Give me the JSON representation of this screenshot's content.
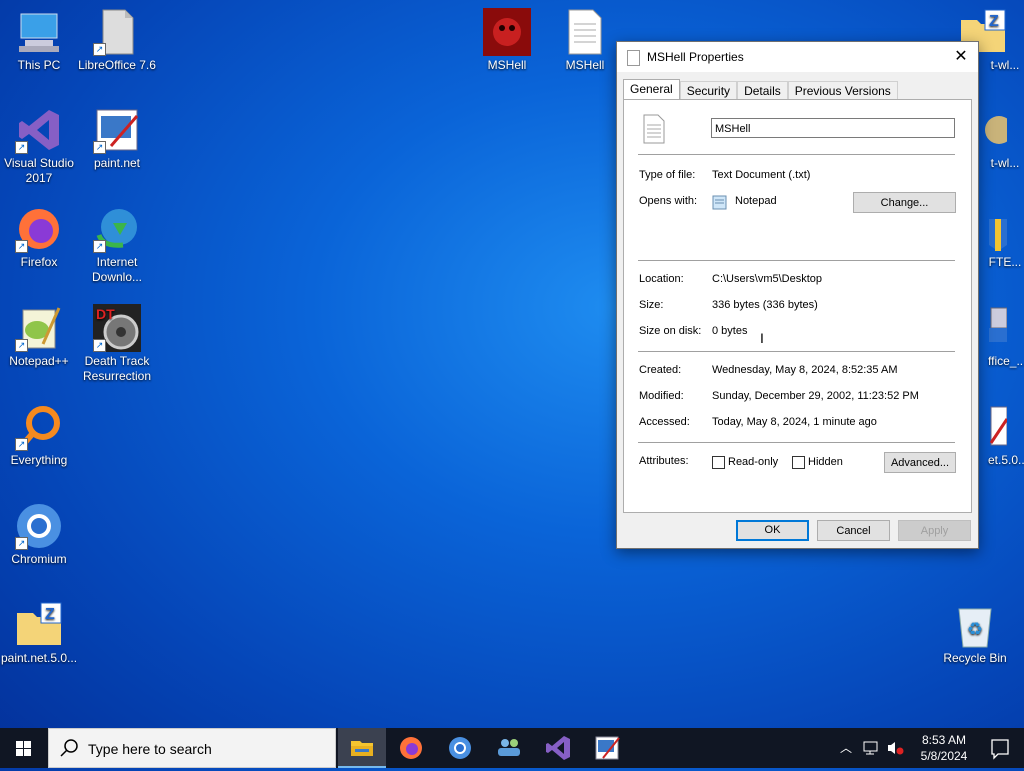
{
  "desktop_icons": [
    {
      "label": "This PC",
      "icon": "computer-icon"
    },
    {
      "label": "LibreOffice 7.6",
      "icon": "libreoffice-icon"
    },
    {
      "label": "Visual Studio 2017",
      "icon": "visual-studio-icon"
    },
    {
      "label": "paint.net",
      "icon": "paintnet-icon"
    },
    {
      "label": "Firefox",
      "icon": "firefox-icon"
    },
    {
      "label": "Internet Downlo...",
      "icon": "internet-download-manager-icon"
    },
    {
      "label": "Notepad++",
      "icon": "notepadpp-icon"
    },
    {
      "label": "Death Track Resurrection",
      "icon": "game-icon"
    },
    {
      "label": "Everything",
      "icon": "everything-search-icon"
    },
    {
      "label": "Chromium",
      "icon": "chromium-icon"
    },
    {
      "label": "paint.net.5.0...",
      "icon": "zip-folder-icon"
    },
    {
      "label": "MSHell",
      "icon": "mshell-icon"
    },
    {
      "label": "MSHell",
      "icon": "text-file-icon"
    },
    {
      "label": "Recycle Bin",
      "icon": "recycle-bin-icon"
    }
  ],
  "right_edge_icons": [
    {
      "label": "t-wl...",
      "icon": "zip-folder-icon"
    },
    {
      "label": "t-wl...",
      "icon": "installer-icon"
    },
    {
      "label": "FTE...",
      "icon": "installer-icon"
    },
    {
      "label": "ffice_...",
      "icon": "installer-icon"
    },
    {
      "label": "et.5.0...",
      "icon": "paintnet-icon"
    }
  ],
  "dialog": {
    "title": "MSHell Properties",
    "close": "✕",
    "tabs": [
      "General",
      "Security",
      "Details",
      "Previous Versions"
    ],
    "active_tab": "General",
    "filename": "MSHell",
    "type_label": "Type of file:",
    "type_value": "Text Document (.txt)",
    "opens_label": "Opens with:",
    "opens_value": "Notepad",
    "change_button": "Change...",
    "location_label": "Location:",
    "location_value": "C:\\Users\\vm5\\Desktop",
    "size_label": "Size:",
    "size_value": "336 bytes (336 bytes)",
    "disk_label": "Size on disk:",
    "disk_value": "0 bytes",
    "created_label": "Created:",
    "created_value": "Wednesday, May 8, 2024, 8:52:35 AM",
    "modified_label": "Modified:",
    "modified_value": "Sunday, December 29, 2002, 11:23:52 PM",
    "accessed_label": "Accessed:",
    "accessed_value": "Today, May 8, 2024, 1 minute ago",
    "attributes_label": "Attributes:",
    "readonly_label": "Read-only",
    "hidden_label": "Hidden",
    "advanced_button": "Advanced...",
    "ok_button": "OK",
    "cancel_button": "Cancel",
    "apply_button": "Apply"
  },
  "taskbar": {
    "search_placeholder": "Type here to search",
    "clock_time": "8:53 AM",
    "clock_date": "5/8/2024",
    "apps": [
      "file-explorer-icon",
      "firefox-icon",
      "chromium-icon",
      "people-icon",
      "visual-studio-icon",
      "paintnet-icon"
    ]
  },
  "colors": {
    "accent": "#0078d7",
    "taskbar": "#101623",
    "desktop": "#0a64d8"
  }
}
